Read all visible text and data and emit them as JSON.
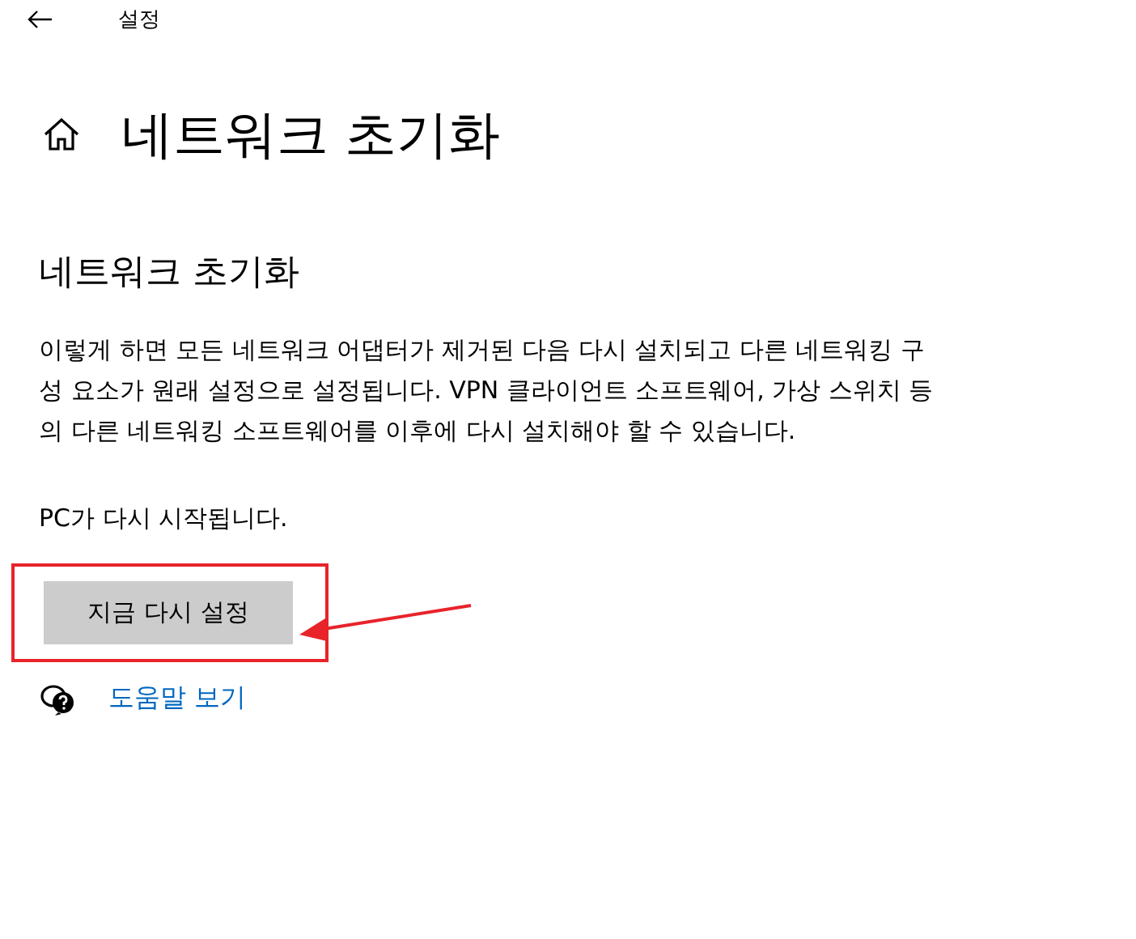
{
  "window": {
    "title": "설정"
  },
  "page_title": "네트워크 초기화",
  "section_heading": "네트워크 초기화",
  "description": "이렇게 하면 모든 네트워크 어댑터가 제거된 다음 다시 설치되고 다른 네트워킹 구성 요소가 원래 설정으로 설정됩니다. VPN 클라이언트 소프트웨어, 가상 스위치 등의 다른 네트워킹 소프트웨어를 이후에 다시 설치해야 할 수 있습니다.",
  "restart_note": "PC가 다시 시작됩니다.",
  "reset_button": {
    "label": "지금 다시 설정"
  },
  "help_link": {
    "label": "도움말 보기"
  }
}
